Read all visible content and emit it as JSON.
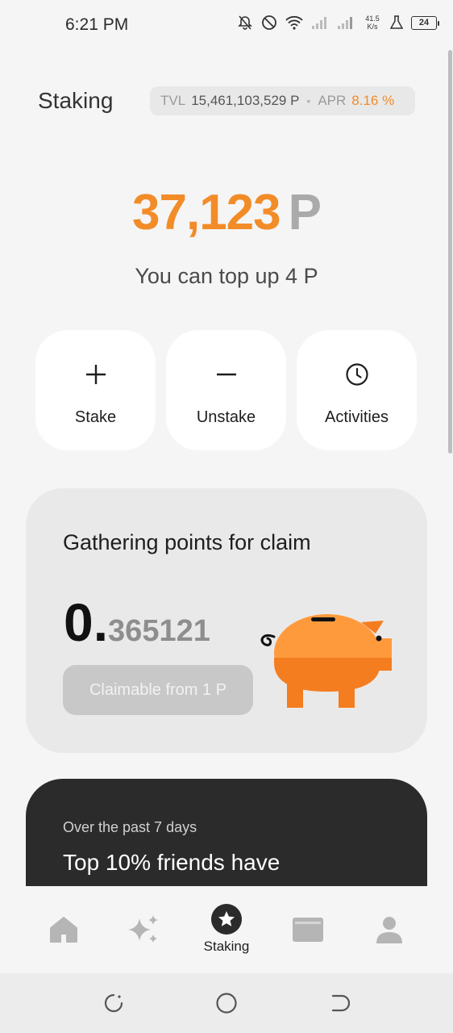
{
  "status_bar": {
    "time": "6:21 PM",
    "net_speed_value": "41.5",
    "net_speed_unit": "K/s",
    "battery": "24"
  },
  "header": {
    "title": "Staking",
    "tvl_label": "TVL",
    "tvl_value": "15,461,103,529 P",
    "separator": "•",
    "apr_label": "APR",
    "apr_value": "8.16 %"
  },
  "balance": {
    "amount": "37,123",
    "unit": "P",
    "topup_text": "You can top up 4 P"
  },
  "actions": [
    {
      "label": "Stake",
      "icon": "plus-icon"
    },
    {
      "label": "Unstake",
      "icon": "minus-icon"
    },
    {
      "label": "Activities",
      "icon": "clock-icon"
    }
  ],
  "gather_card": {
    "title": "Gathering points for claim",
    "value_int": "0.",
    "value_frac": "365121",
    "claim_label": "Claimable from 1 P",
    "illustration": "piggy-bank-icon"
  },
  "promo_card": {
    "subtitle": "Over the past 7 days",
    "title": "Top 10% friends have"
  },
  "bottom_nav": {
    "items": [
      {
        "icon": "home-icon",
        "label": ""
      },
      {
        "icon": "sparkle-icon",
        "label": ""
      },
      {
        "icon": "star-icon",
        "label": "Staking"
      },
      {
        "icon": "wallet-icon",
        "label": ""
      },
      {
        "icon": "profile-icon",
        "label": ""
      }
    ]
  },
  "colors": {
    "accent": "#f28c28",
    "background": "#f5f5f5",
    "card_dark": "#2b2b2b"
  }
}
